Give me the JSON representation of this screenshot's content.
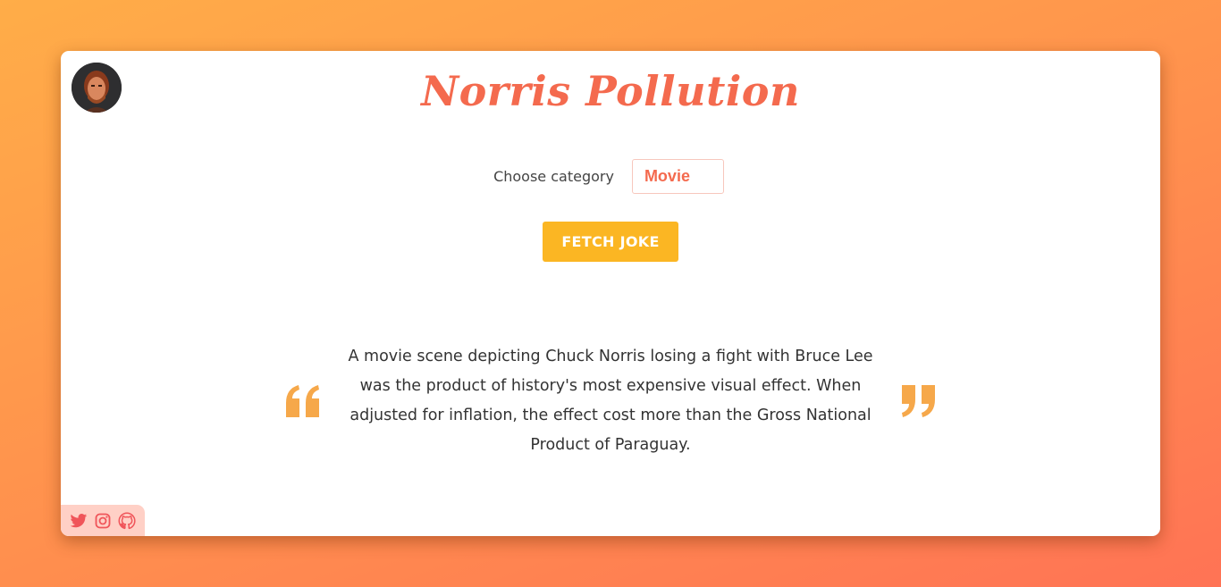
{
  "header": {
    "title": "Norris Pollution"
  },
  "controls": {
    "category_label": "Choose category",
    "category_selected": "Movie",
    "fetch_button": "FETCH JOKE"
  },
  "joke": {
    "text": "A movie scene depicting Chuck Norris losing a fight with Bruce Lee was the product of history's most expensive visual effect. When adjusted for inflation, the effect cost more than the Gross National Product of Paraguay."
  },
  "social": {
    "icons": [
      "twitter-icon",
      "instagram-icon",
      "github-icon"
    ]
  },
  "colors": {
    "accent": "#f46a4e",
    "button": "#fbb623",
    "quote_marks": "#f6a84a",
    "social_bg": "#ffd0c6"
  }
}
